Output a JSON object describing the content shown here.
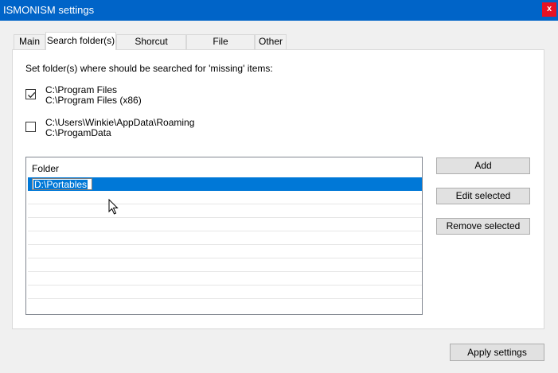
{
  "window": {
    "title": "ISMONISM settings",
    "close_label": "x",
    "accent_color": "#0064c8"
  },
  "tabs": [
    {
      "label": "Main",
      "active": false
    },
    {
      "label": "Search folder(s)",
      "active": true
    },
    {
      "label": "Shorcut folder(s)",
      "active": false
    },
    {
      "label": "File extension(s)",
      "active": false
    },
    {
      "label": "Other",
      "active": false
    }
  ],
  "search": {
    "description": "Set folder(s) where should be searched for 'missing' items:",
    "options": [
      {
        "checked": true,
        "line1": "C:\\Program Files",
        "line2": "C:\\Program Files (x86)"
      },
      {
        "checked": false,
        "line1": "C:\\Users\\Winkie\\AppData\\Roaming",
        "line2": "C:\\ProgamData"
      }
    ],
    "list": {
      "column_header": "Folder",
      "items": [
        "D:\\Portables"
      ],
      "editing_value": "D:\\Portables"
    },
    "buttons": {
      "add": "Add",
      "edit": "Edit selected",
      "remove": "Remove selected"
    }
  },
  "footer": {
    "apply": "Apply settings"
  }
}
